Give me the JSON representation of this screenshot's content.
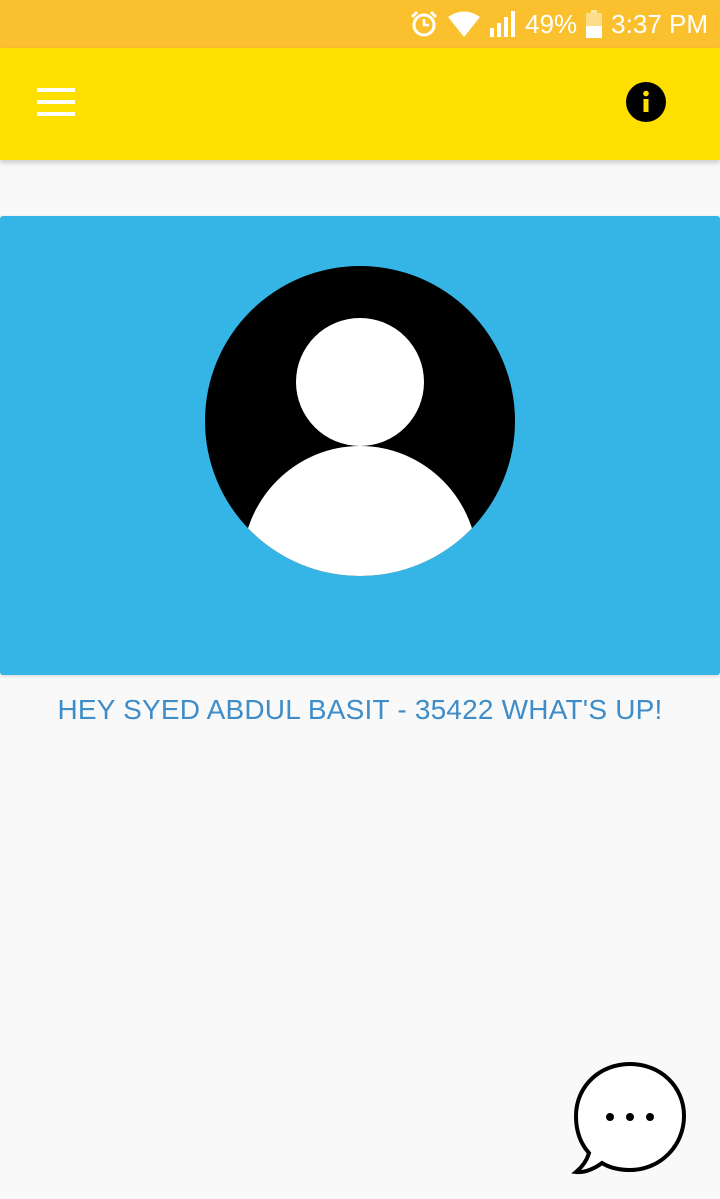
{
  "status_bar": {
    "battery_percent": "49%",
    "time": "3:37 PM",
    "icons": [
      "alarm-icon",
      "wifi-icon",
      "signal-icon",
      "battery-icon"
    ]
  },
  "app_bar": {
    "menu_icon": "hamburger-menu-icon",
    "info_icon": "info-icon",
    "background_color": "#ffdf00"
  },
  "profile": {
    "avatar_icon": "default-avatar-icon",
    "card_color": "#35b5e5",
    "greeting": "HEY SYED ABDUL BASIT - 35422 WHAT'S UP!"
  },
  "fab": {
    "icon": "chat-bubble-icon"
  },
  "colors": {
    "status_bar": "#fbc02d",
    "greeting_text": "#3f8dc8",
    "page_background": "#f9f9f9"
  }
}
